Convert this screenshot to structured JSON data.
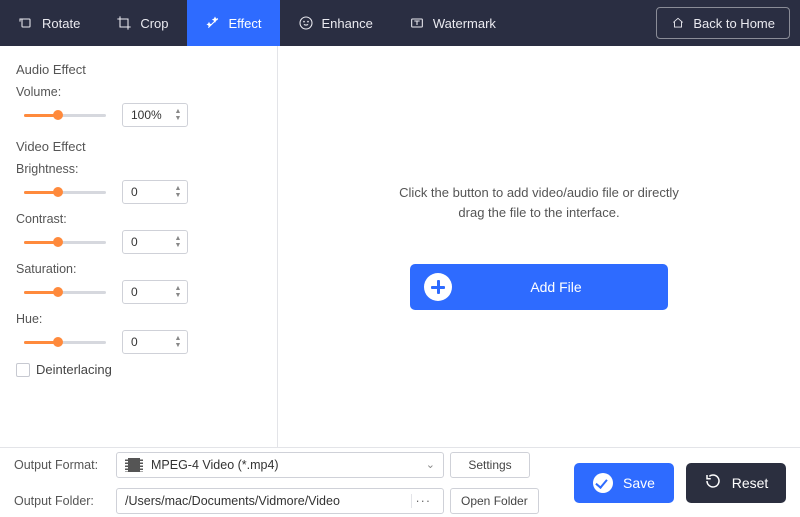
{
  "topbar": {
    "tabs": [
      {
        "label": "Rotate"
      },
      {
        "label": "Crop"
      },
      {
        "label": "Effect"
      },
      {
        "label": "Enhance"
      },
      {
        "label": "Watermark"
      }
    ],
    "back_label": "Back to Home"
  },
  "sidebar": {
    "audio_section": "Audio Effect",
    "volume_label": "Volume:",
    "volume_value": "100%",
    "video_section": "Video Effect",
    "brightness_label": "Brightness:",
    "brightness_value": "0",
    "contrast_label": "Contrast:",
    "contrast_value": "0",
    "saturation_label": "Saturation:",
    "saturation_value": "0",
    "hue_label": "Hue:",
    "hue_value": "0",
    "deinterlace_label": "Deinterlacing"
  },
  "preview": {
    "hint": "Click the button to add video/audio file or directly\ndrag the file to the interface.",
    "add_file": "Add File"
  },
  "bottom": {
    "format_label": "Output Format:",
    "format_value": "MPEG-4 Video (*.mp4)",
    "settings_label": "Settings",
    "folder_label": "Output Folder:",
    "folder_value": "/Users/mac/Documents/Vidmore/Video",
    "open_folder_label": "Open Folder",
    "save_label": "Save",
    "reset_label": "Reset"
  }
}
